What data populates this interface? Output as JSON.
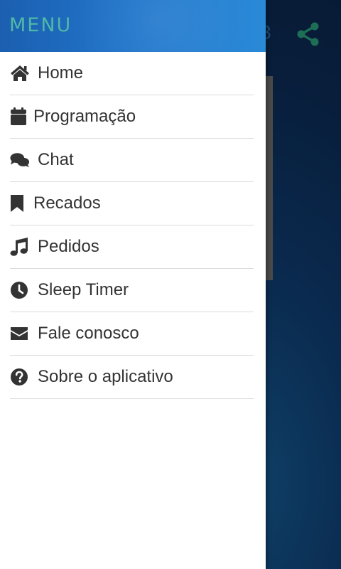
{
  "app": {
    "title_fragment": "3",
    "share_icon": "share-icon"
  },
  "drawer": {
    "title": "MENU",
    "items": [
      {
        "label": "Home",
        "icon": "home-icon"
      },
      {
        "label": "Programação",
        "icon": "calendar-icon"
      },
      {
        "label": "Chat",
        "icon": "chat-icon"
      },
      {
        "label": "Recados",
        "icon": "bookmark-icon"
      },
      {
        "label": "Pedidos",
        "icon": "music-icon"
      },
      {
        "label": "Sleep Timer",
        "icon": "clock-icon"
      },
      {
        "label": "Fale conosco",
        "icon": "envelope-icon"
      },
      {
        "label": "Sobre o aplicativo",
        "icon": "question-circle-icon"
      }
    ]
  },
  "colors": {
    "drawer_header": "#1f73c9",
    "menu_title": "#4fb8a6",
    "menu_text": "#333333",
    "divider": "#dcdcdc",
    "background": "#081e3b",
    "share_icon": "#1e6e55"
  }
}
